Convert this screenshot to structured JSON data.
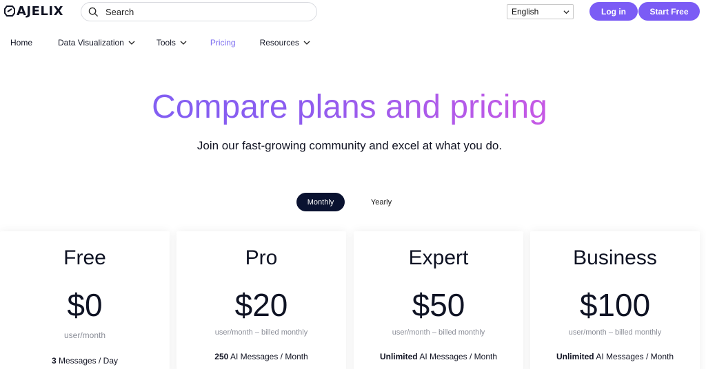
{
  "header": {
    "logo_text": "AJELIX",
    "search_placeholder": "Search",
    "language": "English",
    "login_label": "Log in",
    "start_label": "Start Free",
    "accent_color": "#7b5cf5"
  },
  "nav": {
    "items": [
      {
        "label": "Home",
        "has_dropdown": false
      },
      {
        "label": "Data Visualization",
        "has_dropdown": true
      },
      {
        "label": "Tools",
        "has_dropdown": true
      },
      {
        "label": "Pricing",
        "has_dropdown": false,
        "active": true
      },
      {
        "label": "Resources",
        "has_dropdown": true
      }
    ]
  },
  "hero": {
    "title": "Compare plans and pricing",
    "subtitle": "Join our fast-growing community and excel at what you do."
  },
  "billing_toggle": {
    "monthly": "Monthly",
    "yearly": "Yearly",
    "selected": "Monthly"
  },
  "plans": [
    {
      "name": "Free",
      "price": "$0",
      "billing": "user/month",
      "feature_bold": "3",
      "feature_rest": " Messages / Day"
    },
    {
      "name": "Pro",
      "price": "$20",
      "billing": "user/month – billed monthly",
      "feature_bold": "250",
      "feature_rest": " AI Messages / Month"
    },
    {
      "name": "Expert",
      "price": "$50",
      "billing": "user/month – billed monthly",
      "feature_bold": "Unlimited",
      "feature_rest": " AI Messages / Month"
    },
    {
      "name": "Business",
      "price": "$100",
      "billing": "user/month – billed monthly",
      "feature_bold": "Unlimited",
      "feature_rest": " AI Messages / Month"
    }
  ]
}
